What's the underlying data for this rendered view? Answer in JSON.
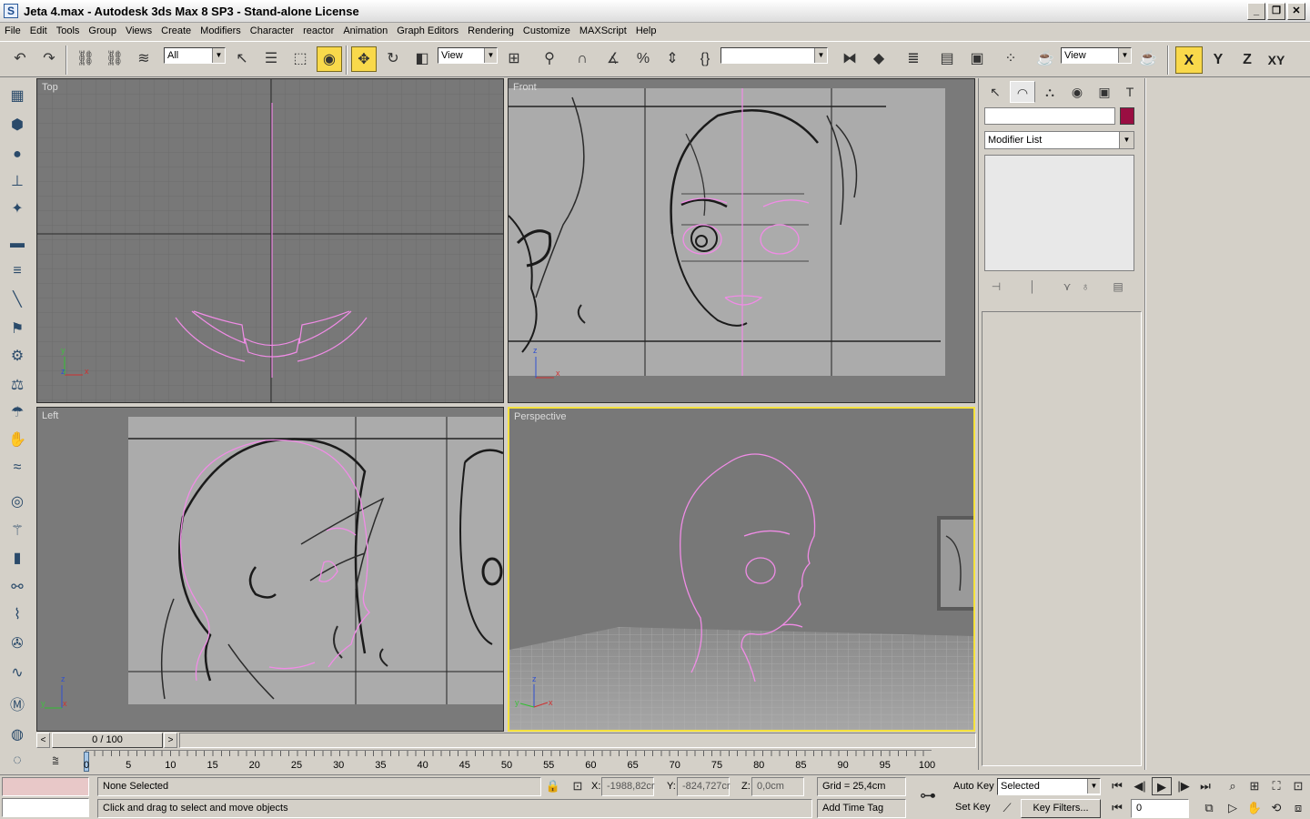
{
  "window": {
    "title": "Jeta 4.max - Autodesk 3ds Max 8 SP3  - Stand-alone License",
    "app_icon_glyph": "S"
  },
  "menu": [
    "File",
    "Edit",
    "Tools",
    "Group",
    "Views",
    "Create",
    "Modifiers",
    "Character",
    "reactor",
    "Animation",
    "Graph Editors",
    "Rendering",
    "Customize",
    "MAXScript",
    "Help"
  ],
  "toolbar": {
    "selection_filter": "All",
    "ref_coord": "View",
    "named_selection": "",
    "render_type": "View",
    "axis": [
      "X",
      "Y",
      "Z",
      "XY"
    ]
  },
  "viewports": {
    "top": "Top",
    "front": "Front",
    "left": "Left",
    "perspective": "Perspective",
    "axis_x": "x",
    "axis_y": "y",
    "axis_z": "z"
  },
  "command_panel": {
    "modifier_list": "Modifier List",
    "object_color": "#9a0e42"
  },
  "time_slider": {
    "frame": "0 / 100",
    "prev": "<",
    "next": ">"
  },
  "track_bar": {
    "ticks": [
      "0",
      "5",
      "10",
      "15",
      "20",
      "25",
      "30",
      "35",
      "40",
      "45",
      "50",
      "55",
      "60",
      "65",
      "70",
      "75",
      "80",
      "85",
      "90",
      "95",
      "100"
    ],
    "current_frame": 0
  },
  "status": {
    "selection": "None Selected",
    "prompt": "Click and drag to select and move objects",
    "x_label": "X:",
    "x_value": "-1988,82cr",
    "y_label": "Y:",
    "y_value": "-824,727cr",
    "z_label": "Z:",
    "z_value": "0,0cm",
    "grid": "Grid = 25,4cm",
    "add_time_tag": "Add Time Tag",
    "auto_key": "Auto Key",
    "set_key": "Set Key",
    "key_mode": "Selected",
    "key_filters": "Key Filters...",
    "current_frame_field": "0"
  },
  "colors": {
    "active_viewport_border": "#f5e23c",
    "selected_spline": "#f08ce6",
    "active_button": "#f9d94b"
  }
}
